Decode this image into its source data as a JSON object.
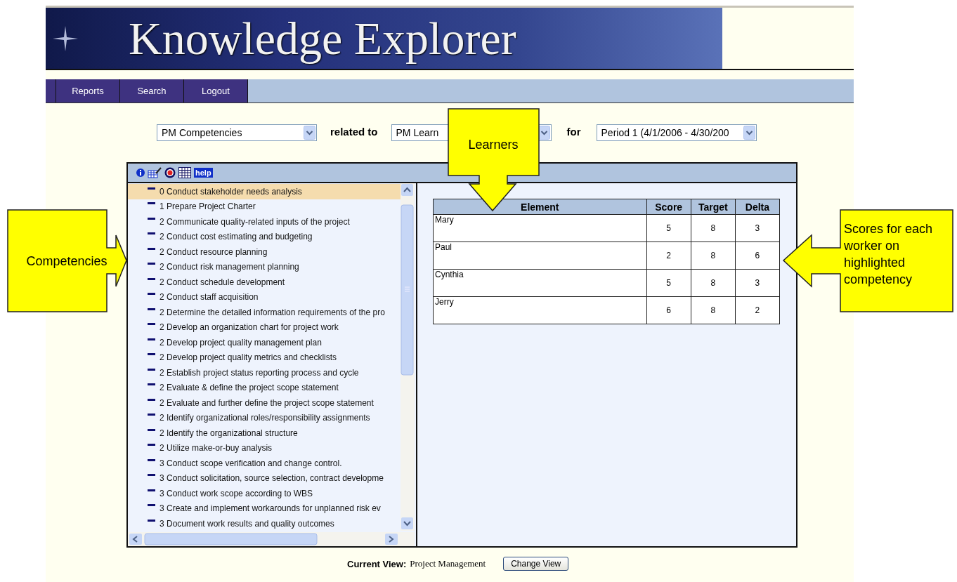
{
  "banner": {
    "title": "Knowledge Explorer"
  },
  "nav": [
    {
      "label": "Reports"
    },
    {
      "label": "Search"
    },
    {
      "label": "Logout"
    }
  ],
  "filters": {
    "primary": "PM Competencies",
    "relation_label": "related to",
    "secondary": "PM Learn",
    "period_label": "for",
    "period": "Period 1 (4/1/2006 - 4/30/200"
  },
  "toolbar": {
    "help": "help"
  },
  "competencies": [
    {
      "label": "0 Conduct stakeholder needs analysis",
      "selected": true
    },
    {
      "label": "1 Prepare Project Charter",
      "selected": false
    },
    {
      "label": "2 Communicate quality-related inputs of the project",
      "selected": false
    },
    {
      "label": "2 Conduct cost estimating and budgeting",
      "selected": false
    },
    {
      "label": "2 Conduct resource planning",
      "selected": false
    },
    {
      "label": "2 Conduct risk management planning",
      "selected": false
    },
    {
      "label": "2 Conduct schedule development",
      "selected": false
    },
    {
      "label": "2 Conduct staff acquisition",
      "selected": false
    },
    {
      "label": "2 Determine the detailed information requirements of the pro",
      "selected": false
    },
    {
      "label": "2 Develop an organization chart for project work",
      "selected": false
    },
    {
      "label": "2 Develop project quality management plan",
      "selected": false
    },
    {
      "label": "2 Develop project quality metrics and checklists",
      "selected": false
    },
    {
      "label": "2 Establish project status reporting process and cycle",
      "selected": false
    },
    {
      "label": "2 Evaluate & define the project scope statement",
      "selected": false
    },
    {
      "label": "2 Evaluate and further define the project scope statement",
      "selected": false
    },
    {
      "label": "2 Identify organizational roles/responsibility assignments",
      "selected": false
    },
    {
      "label": "2 Identify the organizational structure",
      "selected": false
    },
    {
      "label": "2 Utilize make-or-buy analysis",
      "selected": false
    },
    {
      "label": "3 Conduct scope verification and change control.",
      "selected": false
    },
    {
      "label": "3 Conduct solicitation, source selection, contract developme",
      "selected": false
    },
    {
      "label": "3 Conduct work scope according to WBS",
      "selected": false
    },
    {
      "label": "3 Create and implement workarounds for unplanned risk ev",
      "selected": false
    },
    {
      "label": "3 Document work results and quality outcomes",
      "selected": false
    }
  ],
  "table": {
    "columns": [
      "Element",
      "Score",
      "Target",
      "Delta"
    ],
    "rows": [
      {
        "cells": [
          "Mary",
          "5",
          "8",
          "3"
        ]
      },
      {
        "cells": [
          "Paul",
          "2",
          "8",
          "6"
        ]
      },
      {
        "cells": [
          "Cynthia",
          "5",
          "8",
          "3"
        ]
      },
      {
        "cells": [
          "Jerry",
          "6",
          "8",
          "2"
        ]
      }
    ]
  },
  "footer": {
    "label": "Current View:",
    "value": "Project Management",
    "button": "Change View"
  },
  "callouts": [
    {
      "kind": "right",
      "text": "Competencies"
    },
    {
      "kind": "down",
      "text": "Learners"
    },
    {
      "kind": "left",
      "text": "Scores for each worker on highlighted competency"
    }
  ]
}
